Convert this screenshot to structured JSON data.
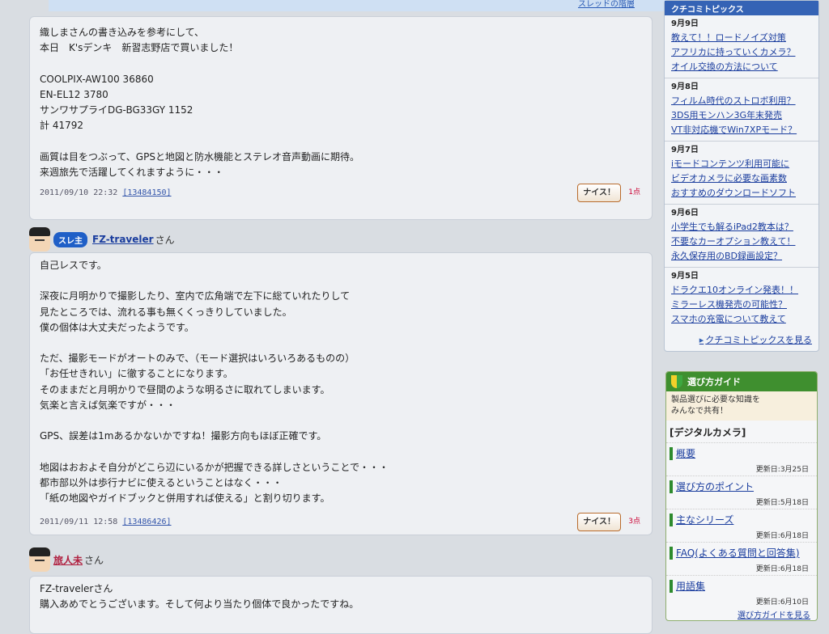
{
  "thread_link": "スレッドの階層",
  "posts": [
    {
      "id": "post-1",
      "lines": [
        "織しまさんの書き込みを参考にして、",
        "本日　K'sデンキ　新習志野店で買いました！",
        "",
        "COOLPIX-AW100 36860",
        "EN-EL12 3780",
        "サンワサプライDG-BG33GY 1152",
        "計 41792",
        "",
        "画質は目をつぶって、GPSと地図と防水機能とステレオ音声動画に期待。",
        "来週旅先で活躍してくれますように・・・"
      ],
      "date": "2011/09/10 22:32",
      "num": "[13484150]",
      "nice": "ナイス！",
      "points": "1点"
    },
    {
      "id": "post-2",
      "author": {
        "badge": "スレ主",
        "name": "FZ-traveler",
        "suffix": "さん"
      },
      "lines": [
        "自己レスです。",
        "",
        "深夜に月明かりで撮影したり、室内で広角端で左下に総ていれたりして",
        "見たところでは、流れる事も無くくっきりしていました。",
        "僕の個体は大丈夫だったようです。",
        "",
        "ただ、撮影モードがオートのみで、（モード選択はいろいろあるものの）",
        "「お任せきれい」に徹することになります。",
        "そのままだと月明かりで昼間のような明るさに取れてしまいます。",
        "気楽と言えば気楽ですが・・・",
        "",
        "GPS、誤差は1mあるかないかですね！撮影方向もほぼ正確です。",
        "",
        "地図はおおよそ自分がどこら辺にいるかが把握できる詳しさということで・・・",
        "都市部以外は歩行ナビに使えるということはなく・・・",
        "「紙の地図やガイドブックと併用すれば使える」と割り切ります。"
      ],
      "date": "2011/09/11 12:58",
      "num": "[13486426]",
      "nice": "ナイス！",
      "points": "3点"
    },
    {
      "id": "post-3",
      "author": {
        "name": "旅人未",
        "suffix": "さん"
      },
      "lines": [
        "FZ-travelerさん",
        "購入あめでとうございます。そして何より当たり個体で良かったですね。"
      ]
    }
  ],
  "topics": {
    "title": "クチコミトピックス",
    "days": [
      {
        "date": "9月9日",
        "items": [
          "教えて！！ロードノイズ対策",
          "アフリカに持っていくカメラ？",
          "オイル交換の方法について"
        ]
      },
      {
        "date": "9月8日",
        "items": [
          "フィルム時代のストロボ利用？",
          "3DS用モンハン3G年末発売",
          "VT非対応機でWin7XPモード？"
        ]
      },
      {
        "date": "9月7日",
        "items": [
          "iモードコンテンツ利用可能に",
          "ビデオカメラに必要な画素数",
          "おすすめのダウンロードソフト"
        ]
      },
      {
        "date": "9月6日",
        "items": [
          "小学生でも解るiPad2教本は？",
          "不要なカーオプション教えて！",
          "永久保存用のBD録画設定？"
        ]
      },
      {
        "date": "9月5日",
        "items": [
          "ドラクエ10オンライン発表！！",
          "ミラーレス機発売の可能性？",
          "スマホの充電について教えて"
        ]
      }
    ],
    "more": "クチコミトピックスを見る"
  },
  "guide": {
    "title": "選び方ガイド",
    "intro": "製品選びに必要な知識を\nみんなで共有！",
    "category": "[デジタルカメラ]",
    "items": [
      {
        "label": "概要",
        "updated": "更新日:3月25日"
      },
      {
        "label": "選び方のポイント",
        "updated": "更新日:5月18日"
      },
      {
        "label": "主なシリーズ",
        "updated": "更新日:6月18日"
      },
      {
        "label": "FAQ(よくある質問と回答集)",
        "updated": "更新日:6月18日"
      },
      {
        "label": "用語集",
        "updated": "更新日:6月10日"
      }
    ],
    "more": "選び方ガイドを見る"
  },
  "colors": {
    "accent": "#3563b5",
    "guide": "#3f8f2f",
    "link": "#1a3d9e",
    "points": "#cc0033"
  }
}
